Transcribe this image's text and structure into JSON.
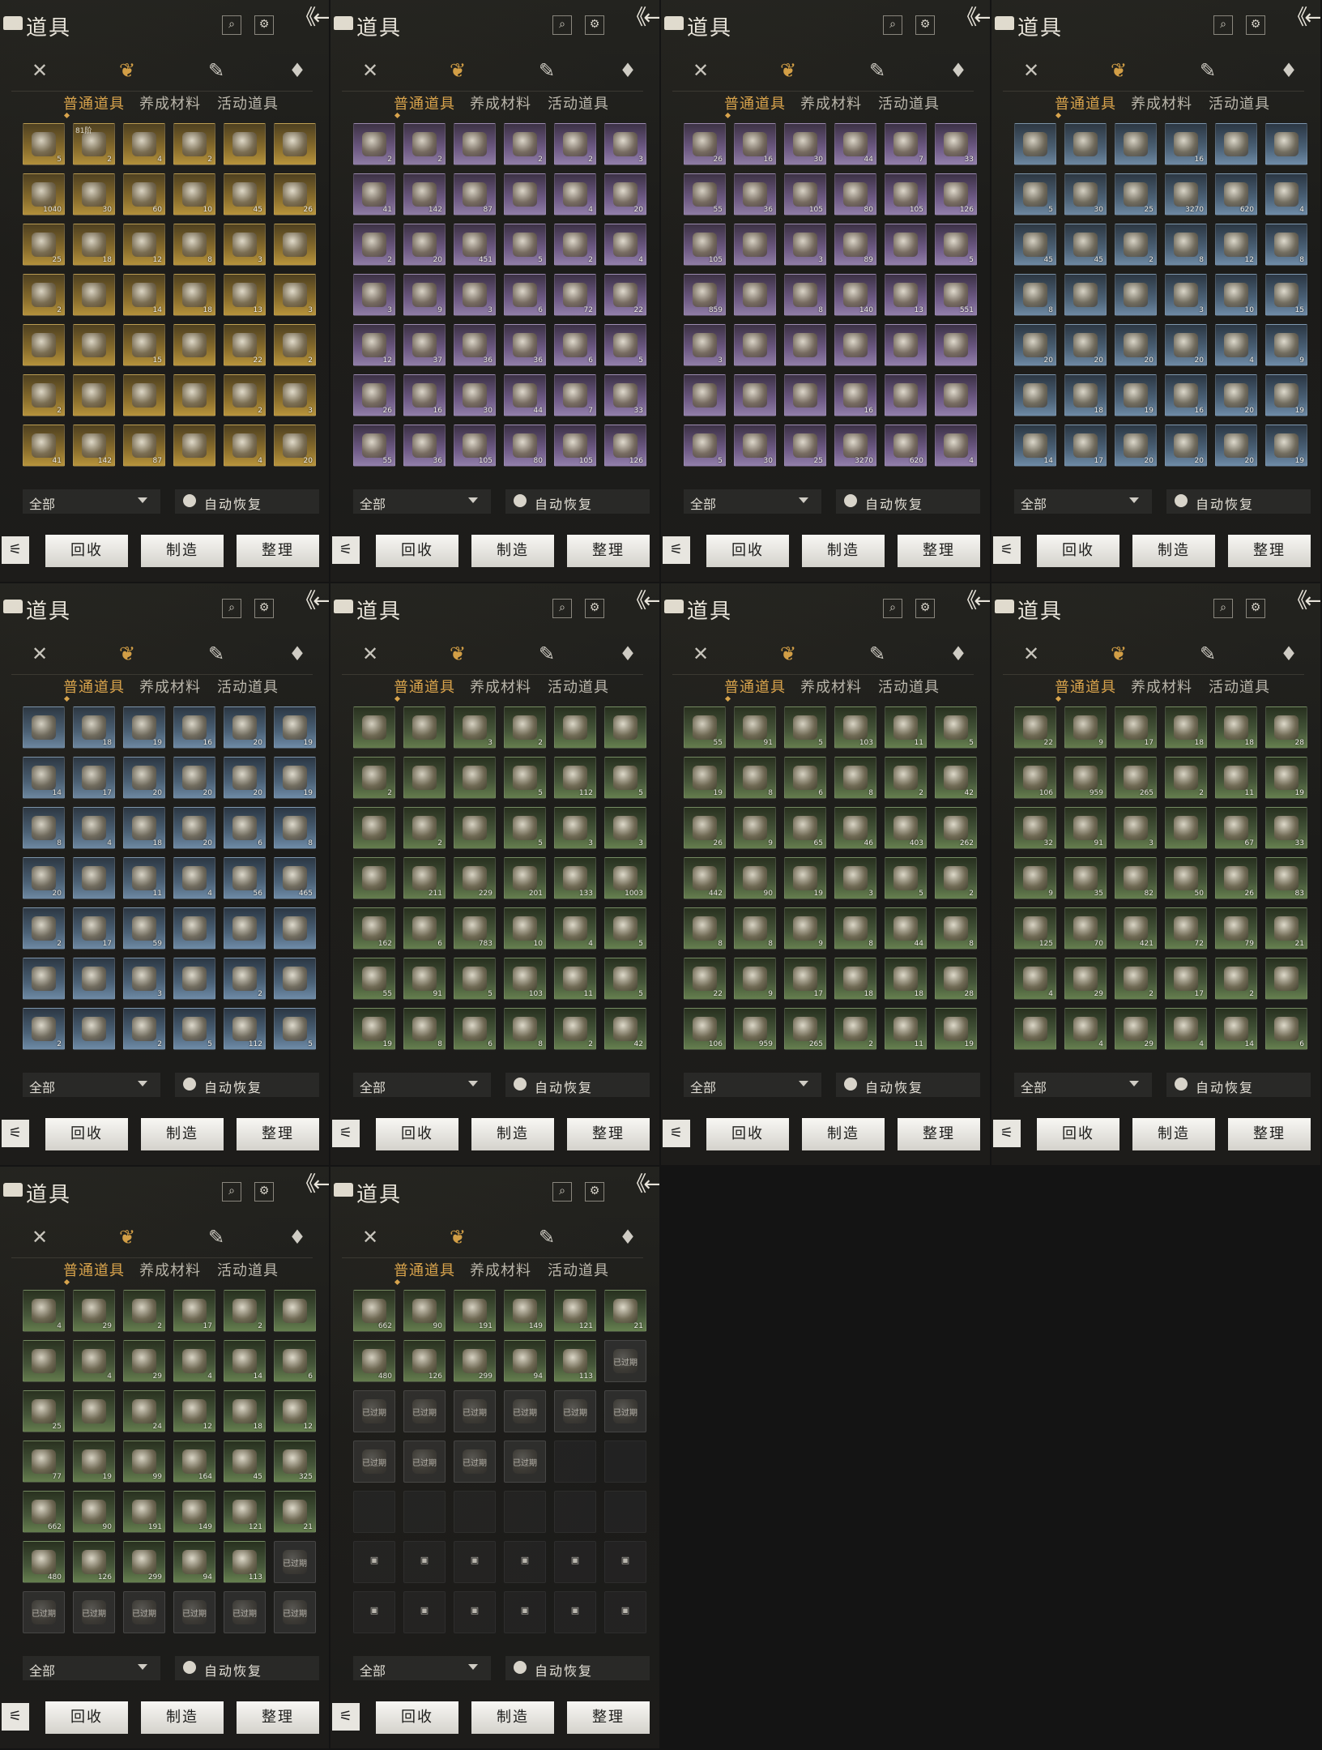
{
  "panel": {
    "title": "道具",
    "tabs": [
      "普通道具",
      "养成材料",
      "活动道具"
    ],
    "filter_value": "全部",
    "auto_restore": "自动恢复",
    "buttons": [
      "回收",
      "制造",
      "整理"
    ]
  },
  "expired_label": "已过期",
  "level_label": "81阶",
  "screens": [
    {
      "tier": "gold",
      "rows": [
        [
          "5",
          "2",
          "4",
          "2",
          "",
          ""
        ],
        [
          "1040",
          "30",
          "60",
          "10",
          "45",
          "26"
        ],
        [
          "25",
          "18",
          "12",
          "8",
          "3",
          ""
        ],
        [
          "2",
          "",
          "14",
          "18",
          "13",
          "3"
        ],
        [
          "",
          "",
          "15",
          "",
          "22",
          "2"
        ],
        [
          "2",
          "",
          "",
          "",
          "2",
          "3"
        ],
        [
          "41",
          "142",
          "87",
          "",
          "4",
          "20"
        ]
      ]
    },
    {
      "tier": "purple",
      "rows": [
        [
          "2",
          "2",
          "",
          "2",
          "2",
          "3"
        ],
        [
          "41",
          "142",
          "87",
          "",
          "4",
          "20"
        ],
        [
          "2",
          "20",
          "451",
          "5",
          "2",
          "4"
        ],
        [
          "3",
          "9",
          "3",
          "6",
          "72",
          "22"
        ],
        [
          "12",
          "37",
          "36",
          "36",
          "6",
          "5"
        ],
        [
          "26",
          "16",
          "30",
          "44",
          "7",
          "33"
        ],
        [
          "55",
          "36",
          "105",
          "80",
          "105",
          "126"
        ]
      ]
    },
    {
      "tier": "purple",
      "rows": [
        [
          "26",
          "16",
          "30",
          "44",
          "7",
          "33"
        ],
        [
          "55",
          "36",
          "105",
          "80",
          "105",
          "126"
        ],
        [
          "105",
          "",
          "3",
          "89",
          "",
          "5"
        ],
        [
          "859",
          "",
          "8",
          "140",
          "13",
          "551"
        ],
        [
          "3",
          "",
          "",
          "",
          "",
          ""
        ],
        [
          "",
          "",
          "",
          "16",
          "",
          ""
        ],
        [
          "5",
          "30",
          "25",
          "3270",
          "620",
          "4"
        ]
      ]
    },
    {
      "tier": "blue",
      "rows": [
        [
          "",
          "",
          "",
          "16",
          "",
          ""
        ],
        [
          "5",
          "30",
          "25",
          "3270",
          "620",
          "4"
        ],
        [
          "45",
          "45",
          "2",
          "8",
          "12",
          "8"
        ],
        [
          "8",
          "",
          "",
          "3",
          "10",
          "15"
        ],
        [
          "20",
          "20",
          "20",
          "20",
          "4",
          "9"
        ],
        [
          "",
          "18",
          "19",
          "16",
          "20",
          "19"
        ],
        [
          "14",
          "17",
          "20",
          "20",
          "20",
          "19"
        ]
      ]
    },
    {
      "tier": "blue",
      "rows": [
        [
          "",
          "18",
          "19",
          "16",
          "20",
          "19"
        ],
        [
          "14",
          "17",
          "20",
          "20",
          "20",
          "19"
        ],
        [
          "8",
          "4",
          "18",
          "20",
          "6",
          "8"
        ],
        [
          "20",
          "",
          "11",
          "4",
          "56",
          "465"
        ],
        [
          "2",
          "17",
          "59",
          "",
          "",
          ""
        ],
        [
          "",
          "",
          "3",
          "",
          "2",
          ""
        ],
        [
          "2",
          "",
          "2",
          "5",
          "112",
          "5"
        ]
      ]
    },
    {
      "tier": "green",
      "rows": [
        [
          "",
          "",
          "3",
          "2",
          "",
          ""
        ],
        [
          "2",
          "",
          "",
          "5",
          "112",
          "5"
        ],
        [
          "",
          "2",
          "",
          "5",
          "3",
          "3"
        ],
        [
          "",
          "211",
          "229",
          "201",
          "133",
          "1003"
        ],
        [
          "162",
          "6",
          "783",
          "10",
          "4",
          "5"
        ],
        [
          "55",
          "91",
          "5",
          "103",
          "11",
          "5"
        ],
        [
          "19",
          "8",
          "6",
          "8",
          "2",
          "42"
        ]
      ]
    },
    {
      "tier": "green",
      "rows": [
        [
          "55",
          "91",
          "5",
          "103",
          "11",
          "5"
        ],
        [
          "19",
          "8",
          "6",
          "8",
          "2",
          "42"
        ],
        [
          "26",
          "9",
          "65",
          "46",
          "403",
          "262"
        ],
        [
          "442",
          "90",
          "19",
          "3",
          "5",
          "2"
        ],
        [
          "8",
          "8",
          "9",
          "8",
          "44",
          "8"
        ],
        [
          "22",
          "9",
          "17",
          "18",
          "18",
          "28"
        ],
        [
          "106",
          "959",
          "265",
          "2",
          "11",
          "19"
        ]
      ]
    },
    {
      "tier": "green",
      "rows": [
        [
          "22",
          "9",
          "17",
          "18",
          "18",
          "28"
        ],
        [
          "106",
          "959",
          "265",
          "2",
          "11",
          "19"
        ],
        [
          "32",
          "91",
          "3",
          "",
          "67",
          "33"
        ],
        [
          "9",
          "35",
          "82",
          "50",
          "26",
          "83"
        ],
        [
          "125",
          "70",
          "421",
          "72",
          "79",
          "21"
        ],
        [
          "4",
          "29",
          "2",
          "17",
          "2",
          ""
        ],
        [
          "",
          "4",
          "29",
          "4",
          "14",
          "6"
        ]
      ]
    },
    {
      "tier": "green",
      "rows": [
        [
          "4",
          "29",
          "2",
          "17",
          "2",
          ""
        ],
        [
          "",
          "4",
          "29",
          "4",
          "14",
          "6"
        ],
        [
          "25",
          "",
          "24",
          "12",
          "18",
          "12"
        ],
        [
          "77",
          "19",
          "99",
          "164",
          "45",
          "325"
        ],
        [
          "662",
          "90",
          "191",
          "149",
          "121",
          "21"
        ],
        [
          "480",
          "126",
          "299",
          "94",
          "113",
          "E"
        ],
        [
          "E",
          "E",
          "E",
          "E",
          "E",
          "E"
        ]
      ]
    },
    {
      "tier": "green",
      "rows": [
        [
          "662",
          "90",
          "191",
          "149",
          "121",
          "21"
        ],
        [
          "480",
          "126",
          "299",
          "94",
          "113",
          "E"
        ],
        [
          "E",
          "E",
          "E",
          "E",
          "E",
          "E"
        ],
        [
          "E",
          "E",
          "E",
          "E",
          "-",
          "-"
        ],
        [
          "-",
          "-",
          "-",
          "-",
          "-",
          "-"
        ],
        [
          "L",
          "L",
          "L",
          "L",
          "L",
          "L"
        ],
        [
          "L",
          "L",
          "L",
          "L",
          "L",
          "L"
        ]
      ]
    }
  ]
}
